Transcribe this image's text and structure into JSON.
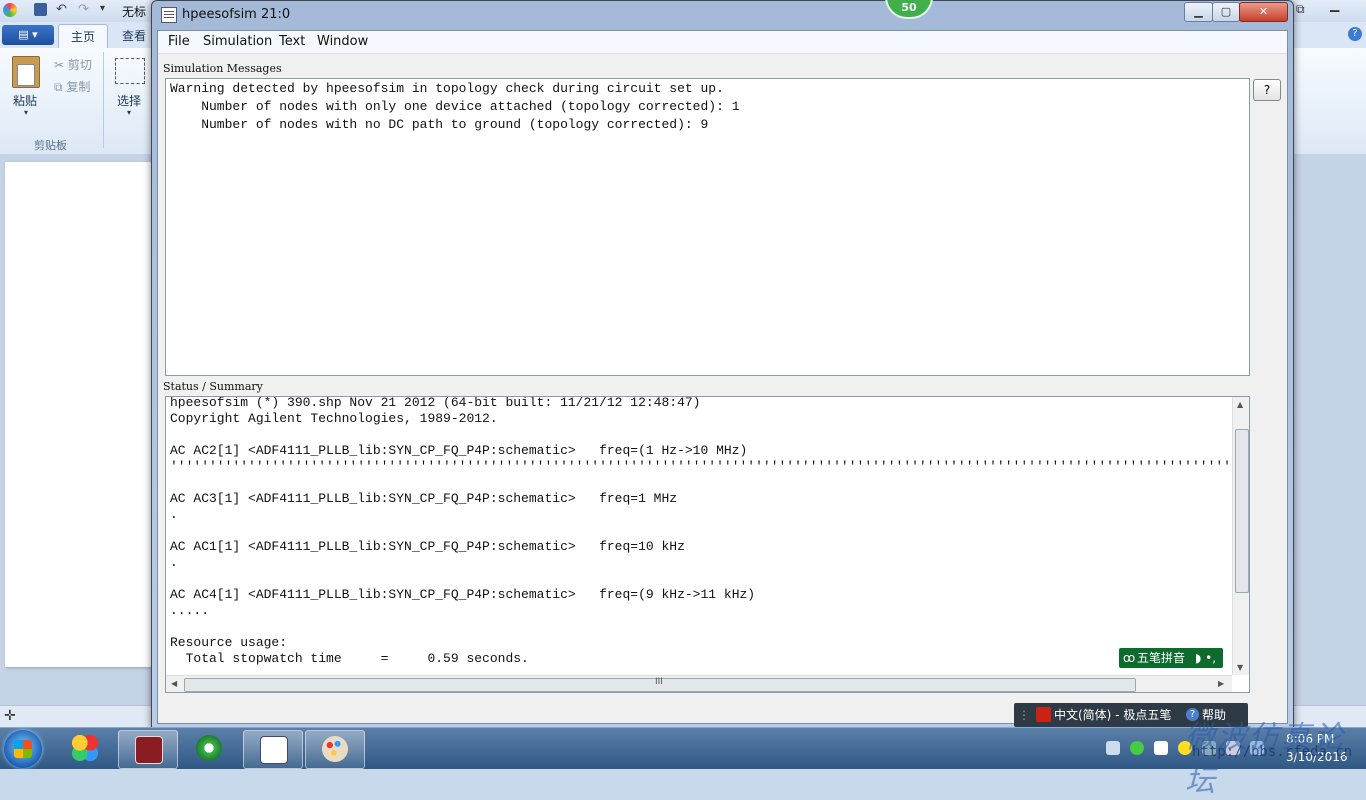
{
  "paint": {
    "title_partial": "无标",
    "menu_button": "▤ ▾",
    "tabs": [
      "主页",
      "查看"
    ],
    "ribbon": {
      "paste": "粘贴",
      "cut": "剪切",
      "copy": "复制",
      "select": "选择",
      "group_label": "剪贴板"
    },
    "status_icon": "✛"
  },
  "sim_window": {
    "title": "hpeesofsim 21:0",
    "badge": "50",
    "controls": {
      "minimize": "▁",
      "maximize": "▢",
      "close": "✕"
    },
    "menu": [
      "File",
      "Simulation",
      "Text",
      "Window"
    ],
    "messages": {
      "label": "Simulation Messages",
      "lines": [
        "Warning detected by hpeesofsim in topology check during circuit set up.",
        "    Number of nodes with only one device attached (topology corrected): 1",
        "    Number of nodes with no DC path to ground (topology corrected): 9"
      ],
      "help_button": "?"
    },
    "status": {
      "label": "Status / Summary",
      "lines": [
        "hpeesofsim (*) 390.shp Nov 21 2012 (64-bit built: 11/21/12 12:48:47)",
        "Copyright Agilent Technologies, 1989-2012.",
        "",
        "AC AC2[1] <ADF4111_PLLB_lib:SYN_CP_FQ_P4P:schematic>   freq=(1 Hz->10 MHz)",
        "''''''''''''''''''''''''''''''''''''''''''''''''''''''''''''''''''''''''''''''''''''''''''''''''''''''''''''''''''''''''''''''''''''''''''''''''''''''''''''''''''''''''''''''''''''''''''''''''''''''''''''''''''''''''''''''''''''''''''''''''''",
        "",
        "AC AC3[1] <ADF4111_PLLB_lib:SYN_CP_FQ_P4P:schematic>   freq=1 MHz",
        ".",
        "",
        "AC AC1[1] <ADF4111_PLLB_lib:SYN_CP_FQ_P4P:schematic>   freq=10 kHz",
        ".",
        "",
        "AC AC4[1] <ADF4111_PLLB_lib:SYN_CP_FQ_P4P:schematic>   freq=(9 kHz->11 kHz)",
        ".....",
        "",
        "Resource usage:",
        "  Total stopwatch time     =     0.59 seconds."
      ],
      "hscroll_grip": "III"
    }
  },
  "ime": {
    "label": "五笔拼音",
    "prefix": "ꝏ",
    "suffix": "◗ •,"
  },
  "langbar": {
    "text": "中文(简体) - 极点五笔",
    "help": "帮助"
  },
  "taskbar": {
    "clock_time": "8:06 PM",
    "clock_date": "3/10/2016"
  },
  "watermark": {
    "text": "微波仿真论坛",
    "url": "http://bbs.rfeda.cn"
  }
}
